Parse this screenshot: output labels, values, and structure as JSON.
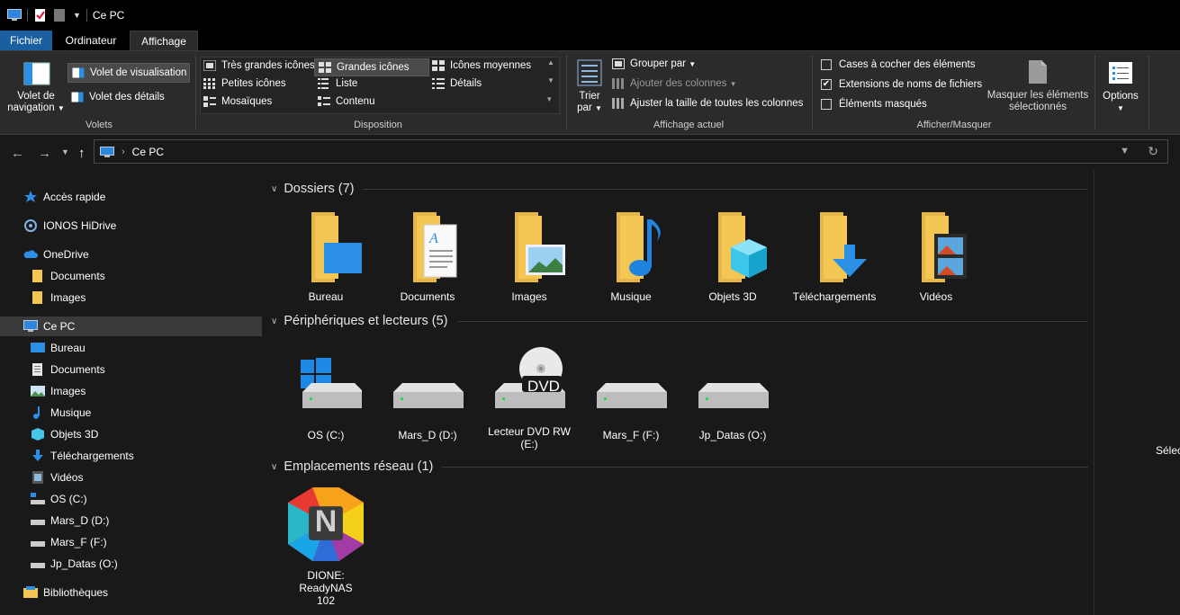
{
  "window": {
    "title": "Ce PC"
  },
  "tabs": {
    "file": "Fichier",
    "computer": "Ordinateur",
    "view": "Affichage"
  },
  "ribbon": {
    "panes": {
      "label": "Volets",
      "nav_pane": "Volet de navigation",
      "preview_pane": "Volet de visualisation",
      "details_pane": "Volet des détails"
    },
    "layout": {
      "label": "Disposition",
      "extra_large": "Très grandes icônes",
      "large": "Grandes icônes",
      "medium": "Icônes moyennes",
      "small": "Petites icônes",
      "list": "Liste",
      "details": "Détails",
      "tiles": "Mosaïques",
      "content": "Contenu"
    },
    "current_view": {
      "label": "Affichage actuel",
      "sort_by": "Trier par",
      "group_by": "Grouper par",
      "add_columns": "Ajouter des colonnes",
      "size_columns": "Ajuster la taille de toutes les colonnes"
    },
    "show_hide": {
      "label": "Afficher/Masquer",
      "checkboxes": "Cases à cocher des éléments",
      "extensions": "Extensions de noms de fichiers",
      "hidden": "Éléments masqués",
      "hide_selected": "Masquer les éléments sélectionnés"
    },
    "options": "Options"
  },
  "address": {
    "path": "Ce PC"
  },
  "sidebar": {
    "items": [
      {
        "label": "Accès rapide",
        "icon": "star-icon"
      },
      {
        "label": "IONOS HiDrive",
        "icon": "hidrive-icon"
      },
      {
        "label": "OneDrive",
        "icon": "cloud-icon"
      },
      {
        "label": "Documents",
        "icon": "folder-icon"
      },
      {
        "label": "Images",
        "icon": "folder-icon"
      },
      {
        "label": "Ce PC",
        "icon": "computer-icon"
      },
      {
        "label": "Bureau",
        "icon": "desktop-icon"
      },
      {
        "label": "Documents",
        "icon": "document-icon"
      },
      {
        "label": "Images",
        "icon": "picture-icon"
      },
      {
        "label": "Musique",
        "icon": "music-icon"
      },
      {
        "label": "Objets 3D",
        "icon": "cube-icon"
      },
      {
        "label": "Téléchargements",
        "icon": "download-icon"
      },
      {
        "label": "Vidéos",
        "icon": "video-icon"
      },
      {
        "label": "OS (C:)",
        "icon": "windows-drive-icon"
      },
      {
        "label": "Mars_D (D:)",
        "icon": "drive-icon"
      },
      {
        "label": "Mars_F (F:)",
        "icon": "drive-icon"
      },
      {
        "label": "Jp_Datas (O:)",
        "icon": "drive-icon"
      },
      {
        "label": "Bibliothèques",
        "icon": "library-icon"
      }
    ]
  },
  "main": {
    "folders": {
      "heading": "Dossiers (7)",
      "items": [
        "Bureau",
        "Documents",
        "Images",
        "Musique",
        "Objets 3D",
        "Téléchargements",
        "Vidéos"
      ]
    },
    "devices": {
      "heading": "Périphériques et lecteurs (5)",
      "items": [
        "OS (C:)",
        "Mars_D (D:)",
        "Lecteur DVD RW (E:)",
        "Mars_F (F:)",
        "Jp_Datas (O:)"
      ],
      "dvd_text": "DVD"
    },
    "network": {
      "heading": "Emplacements réseau (1)",
      "items": [
        "DIONE: ReadyNAS 102"
      ],
      "logo_letter": "N"
    }
  },
  "preview": {
    "text": "Sélec"
  },
  "colors": {
    "file_tab": "#1a5fa0",
    "folder": "#f4c653",
    "accent_blue": "#2b8fe6"
  }
}
